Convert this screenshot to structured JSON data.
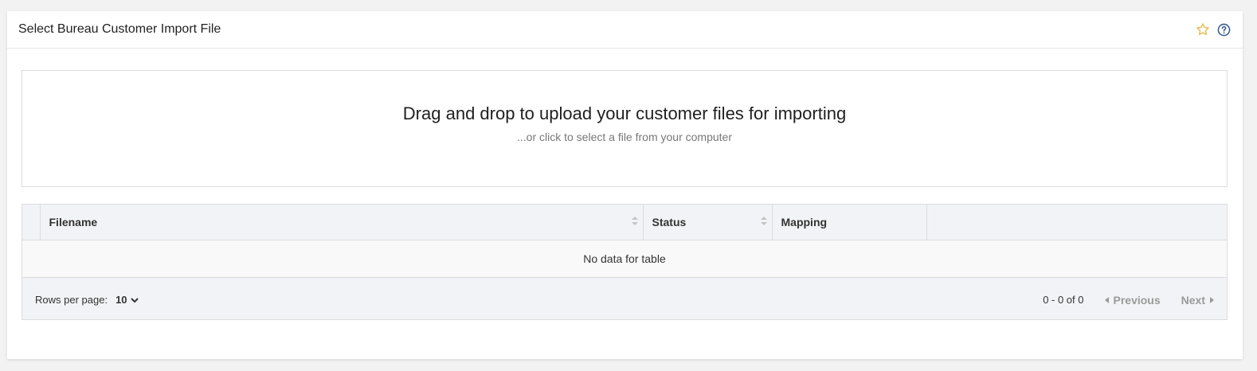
{
  "header": {
    "title": "Select Bureau Customer Import File",
    "icons": [
      "star-icon",
      "help-icon"
    ],
    "colors": {
      "star": "#e8b84a",
      "help": "#3b5c8c"
    }
  },
  "dropzone": {
    "title": "Drag and drop to upload your customer files for importing",
    "subtitle": "...or click to select a file from your computer"
  },
  "table": {
    "columns": [
      {
        "label": "Filename",
        "sortable": true
      },
      {
        "label": "Status",
        "sortable": true
      },
      {
        "label": "Mapping",
        "sortable": false
      },
      {
        "label": "",
        "sortable": false
      }
    ],
    "empty_message": "No data for table",
    "footer": {
      "rows_per_page_label": "Rows per page:",
      "rows_per_page_value": "10",
      "range": "0 - 0 of 0",
      "previous_label": "Previous",
      "next_label": "Next"
    }
  }
}
